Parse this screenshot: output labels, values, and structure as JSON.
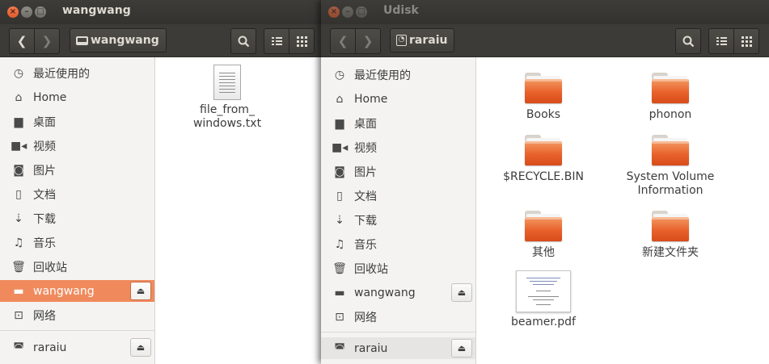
{
  "left_window": {
    "title": "wangwang",
    "path": "wangwang",
    "sidebar": {
      "places": [
        {
          "label": "最近使用的",
          "icon": "clock-icon"
        },
        {
          "label": "Home",
          "icon": "home-icon"
        },
        {
          "label": "桌面",
          "icon": "folder-icon"
        },
        {
          "label": "视频",
          "icon": "video-icon"
        },
        {
          "label": "图片",
          "icon": "camera-icon"
        },
        {
          "label": "文档",
          "icon": "document-icon"
        },
        {
          "label": "下载",
          "icon": "download-icon"
        },
        {
          "label": "音乐",
          "icon": "music-icon"
        },
        {
          "label": "回收站",
          "icon": "trash-icon"
        }
      ],
      "devices": [
        {
          "label": "wangwang",
          "icon": "drive-icon",
          "selected": true
        }
      ],
      "network": {
        "label": "网络",
        "icon": "network-icon"
      },
      "bottom": {
        "label": "raraiu",
        "icon": "usb-drive-icon"
      }
    },
    "files": [
      {
        "name_line1": "file_from_",
        "name_line2": "windows.txt",
        "type": "text-file-icon"
      }
    ]
  },
  "right_window": {
    "title": "Udisk",
    "path": "raraiu",
    "sidebar": {
      "places": [
        {
          "label": "最近使用的",
          "icon": "clock-icon"
        },
        {
          "label": "Home",
          "icon": "home-icon"
        },
        {
          "label": "桌面",
          "icon": "folder-icon"
        },
        {
          "label": "视频",
          "icon": "video-icon"
        },
        {
          "label": "图片",
          "icon": "camera-icon"
        },
        {
          "label": "文档",
          "icon": "document-icon"
        },
        {
          "label": "下载",
          "icon": "download-icon"
        },
        {
          "label": "音乐",
          "icon": "music-icon"
        },
        {
          "label": "回收站",
          "icon": "trash-icon"
        }
      ],
      "devices": [
        {
          "label": "wangwang",
          "icon": "drive-icon"
        }
      ],
      "network": {
        "label": "网络",
        "icon": "network-icon"
      },
      "bottom": {
        "label": "raraiu",
        "icon": "usb-drive-icon",
        "hover": true
      }
    },
    "files": [
      {
        "name_line1": "Books",
        "name_line2": "",
        "type": "folder-icon"
      },
      {
        "name_line1": "phonon",
        "name_line2": "",
        "type": "folder-icon"
      },
      {
        "name_line1": "$RECYCLE.BIN",
        "name_line2": "",
        "type": "folder-icon"
      },
      {
        "name_line1": "System Volume",
        "name_line2": "Information",
        "type": "folder-icon"
      },
      {
        "name_line1": "其他",
        "name_line2": "",
        "type": "folder-icon"
      },
      {
        "name_line1": "新建文件夹",
        "name_line2": "",
        "type": "folder-icon"
      },
      {
        "name_line1": "beamer.pdf",
        "name_line2": "",
        "type": "pdf-file-icon"
      }
    ]
  },
  "colors": {
    "selection": "#f08a5d",
    "close_button": "#e35a2a",
    "folder": "#e8612b",
    "titlebar": "#3c3b37"
  }
}
